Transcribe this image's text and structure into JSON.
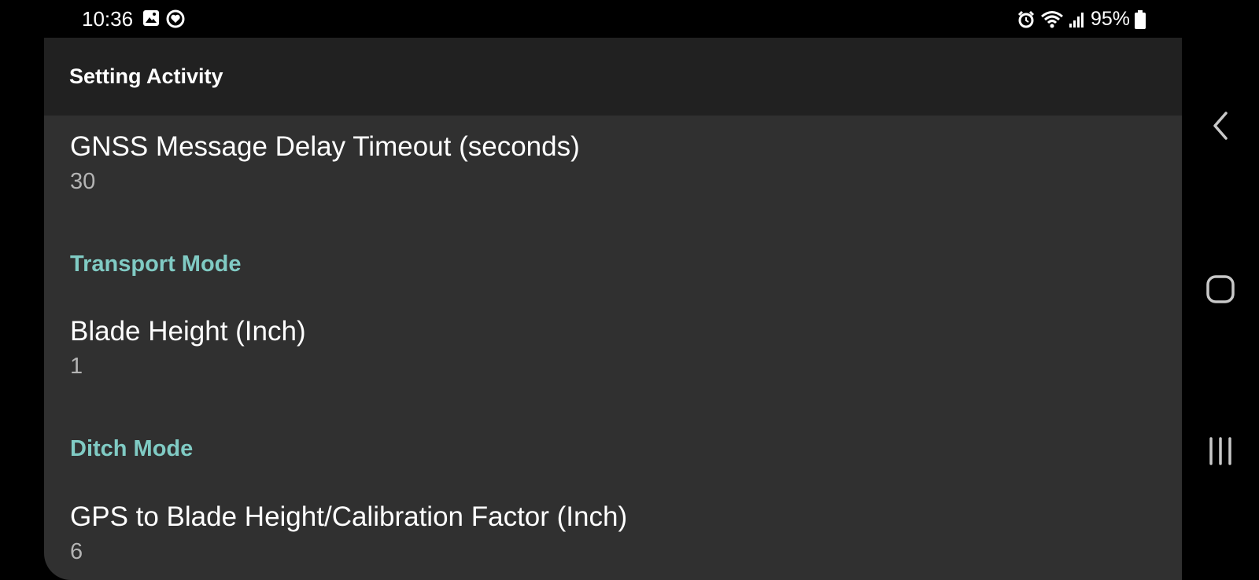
{
  "status_bar": {
    "time": "10:36",
    "left_icons": [
      "image-notification-icon",
      "app-notification-icon"
    ],
    "right_icons": [
      "alarm-icon",
      "wifi-icon",
      "signal-icon"
    ],
    "battery_percent": "95%"
  },
  "app_bar": {
    "title": "Setting Activity"
  },
  "preferences": {
    "gnss_timeout": {
      "title": "GNSS Message Delay Timeout (seconds)",
      "value": "30"
    },
    "transport_category": "Transport Mode",
    "blade_height": {
      "title": "Blade Height (Inch)",
      "value": "1"
    },
    "ditch_category": "Ditch Mode",
    "gps_blade_calibration": {
      "title": "GPS to Blade Height/Calibration Factor (Inch)",
      "value": "6"
    }
  },
  "navigation": [
    "back-icon",
    "home-icon",
    "recents-icon"
  ],
  "colors": {
    "accent": "#80cbc4",
    "app_background": "#303030",
    "toolbar_background": "#212121"
  }
}
